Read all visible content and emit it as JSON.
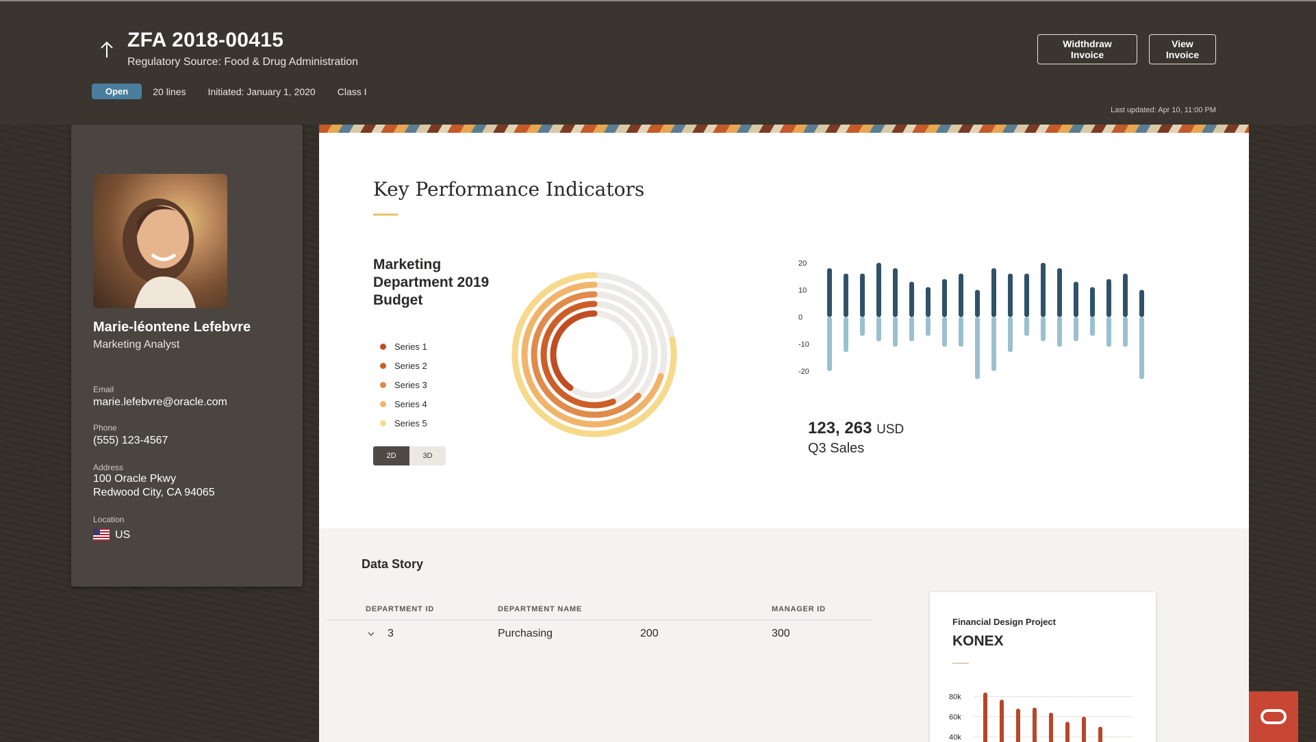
{
  "header": {
    "title": "ZFA 2018-00415",
    "subtitle": "Regulatory Source: Food & Drug Administration",
    "status_badge": "Open",
    "lines": "20 lines",
    "initiated": "Initiated: January 1, 2020",
    "class": "Class I",
    "withdraw_button": "Widthdraw Invoice",
    "view_button": "View Invoice",
    "last_updated": "Last updated: Apr 10, 11:00 PM"
  },
  "profile": {
    "name": "Marie-léontene Lefebvre",
    "role": "Marketing Analyst",
    "email_label": "Email",
    "email": "marie.lefebvre@oracle.com",
    "phone_label": "Phone",
    "phone": "(555) 123-4567",
    "address_label": "Address",
    "address_line1": "100 Oracle Pkwy",
    "address_line2": "Redwood City, CA 94065",
    "location_label": "Location",
    "location": "US"
  },
  "kpi": {
    "title": "Key Performance Indicators",
    "budget_title": "Marketing Department 2019 Budget",
    "toggle": [
      "2D",
      "3D"
    ],
    "sales_value": "123, 263",
    "sales_unit": "USD",
    "sales_label": "Q3 Sales"
  },
  "chart_data": [
    {
      "type": "pie",
      "subtype": "radial-bar",
      "title": "Marketing Department 2019 Budget",
      "series": [
        {
          "name": "Series 1",
          "value": 0.4,
          "color": "#c14d22"
        },
        {
          "name": "Series 2",
          "value": 0.56,
          "color": "#cc5f29"
        },
        {
          "name": "Series 3",
          "value": 0.63,
          "color": "#e08a4c"
        },
        {
          "name": "Series 4",
          "value": 0.7,
          "color": "#f0b46b"
        },
        {
          "name": "Series 5",
          "value": 0.78,
          "color": "#f7d98b"
        }
      ],
      "track_color": "#ebeae8"
    },
    {
      "type": "bar",
      "subtype": "diverging",
      "yticks": [
        20,
        10,
        0,
        -10,
        -20
      ],
      "ylim": [
        -20,
        20
      ],
      "series": [
        {
          "name": "positive",
          "color": "#2f5268",
          "values": [
            18,
            16,
            16,
            20,
            18,
            13,
            11,
            14,
            16,
            10,
            18,
            16,
            16,
            20,
            18,
            13,
            11,
            14,
            16,
            10
          ]
        },
        {
          "name": "negative",
          "color": "#9ac0cf",
          "values": [
            -20,
            -13,
            -7,
            -9,
            -11,
            -9,
            -7,
            -11,
            -11,
            -23,
            -20,
            -13,
            -7,
            -9,
            -11,
            -9,
            -7,
            -11,
            -11,
            -23
          ]
        }
      ]
    },
    {
      "type": "bar",
      "title": "KONEX",
      "yticks": [
        "80k",
        "60k",
        "40k"
      ],
      "ylim": [
        0,
        90000
      ],
      "color": "#b7472a",
      "values": [
        84000,
        77000,
        68000,
        69000,
        64000,
        55000,
        60000,
        50000
      ]
    }
  ],
  "data_story": {
    "title": "Data Story",
    "columns": [
      "DEPARTMENT ID",
      "DEPARTMENT  NAME",
      "MANAGER ID"
    ],
    "rows": [
      {
        "id": "3",
        "name": "Purchasing",
        "extra": "200",
        "manager": "300"
      }
    ]
  },
  "konex": {
    "subtitle": "Financial Design Project",
    "title": "KONEX"
  }
}
